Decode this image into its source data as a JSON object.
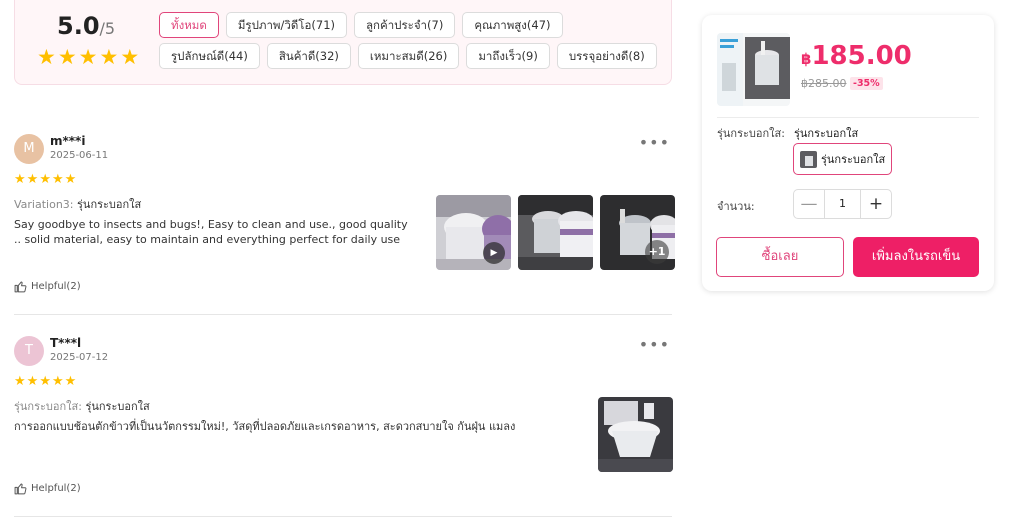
{
  "summary": {
    "score": "5.0",
    "score_max": "/5",
    "stars": "★★★★★",
    "filters": [
      {
        "label": "ทั้งหมด",
        "active": true
      },
      {
        "label": "มีรูปภาพ/วิดีโอ(71)"
      },
      {
        "label": "ลูกค้าประจำ(7)"
      },
      {
        "label": "คุณภาพสูง(47)"
      },
      {
        "label": "รูปลักษณ์ดี(44)"
      },
      {
        "label": "สินค้าดี(32)"
      },
      {
        "label": "เหมาะสมดี(26)"
      },
      {
        "label": "มาถึงเร็ว(9)"
      },
      {
        "label": "บรรจุอย่างดี(8)"
      }
    ]
  },
  "reviews": [
    {
      "avatar_initial": "M",
      "avatar_color": "#e8c2a3",
      "username": "m***i",
      "date": "2025-06-11",
      "stars": "★★★★★",
      "variation_label": "Variation3:",
      "variation_value": "รุ่นกระบอกใส",
      "text": "Say goodbye to insects and bugs!, Easy to clean and use., good quality .. solid material, easy to maintain and everything perfect for daily use",
      "helpful": "Helpful(2)",
      "more_count": "+1"
    },
    {
      "avatar_initial": "T",
      "avatar_color": "#ecc4d4",
      "username": "T***l",
      "date": "2025-07-12",
      "stars": "★★★★★",
      "variation_label": "รุ่นกระบอกใส:",
      "variation_value": "รุ่นกระบอกใส",
      "text": "การออกแบบช้อนตักข้าวที่เป็นนวัตกรรมใหม่!, วัสดุที่ปลอดภัยและเกรดอาหาร, สะดวกสบายใจ กันฝุ่น แมลง",
      "helpful": "Helpful(2)"
    }
  ],
  "product": {
    "currency": "฿",
    "price": "185.00",
    "old_price": "฿285.00",
    "discount": "-35%",
    "variation_label": "รุ่นกระบอกใส:",
    "variation_value": "รุ่นกระบอกใส",
    "variation_option": "รุ่นกระบอกใส",
    "quantity_label": "จำนวน:",
    "quantity": "1",
    "minus": "—",
    "plus": "+",
    "buy_now": "ซื้อเลย",
    "add_to_cart": "เพิ่มลงในรถเข็น"
  },
  "colors": {
    "accent": "#ee2d6b",
    "star": "#ffbf00"
  }
}
